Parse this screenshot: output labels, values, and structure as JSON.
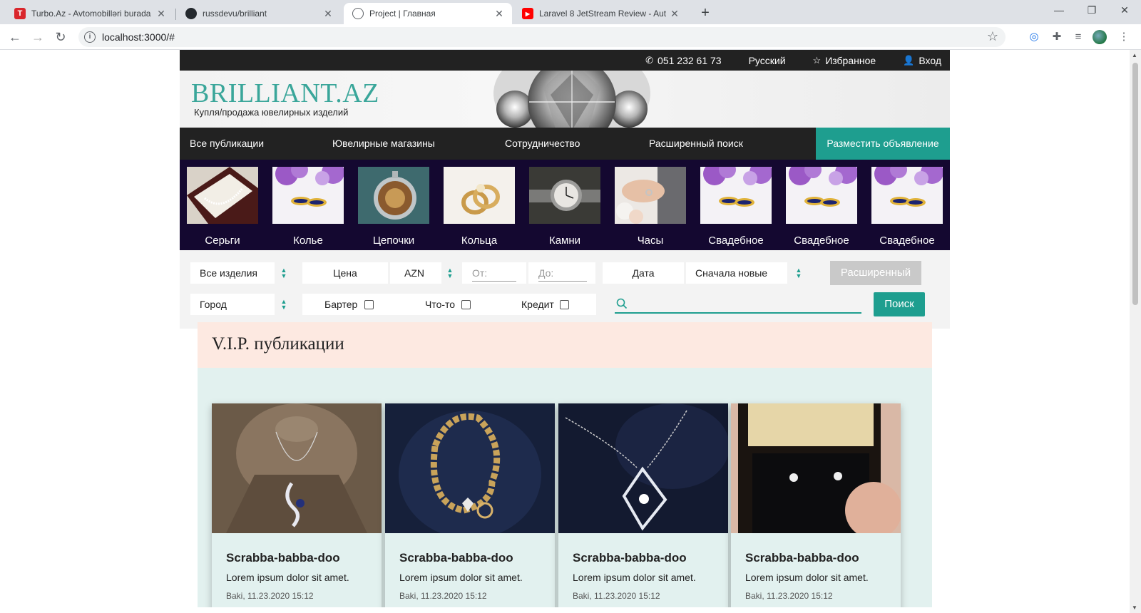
{
  "browser": {
    "tabs": [
      {
        "title": "Turbo.Az - Avtomobillәri burada",
        "favicon": "T"
      },
      {
        "title": "russdevu/brilliant",
        "favicon": ""
      },
      {
        "title": "Project | Главная",
        "favicon": ""
      },
      {
        "title": "Laravel 8 JetStream Review - Aut",
        "favicon": "▶"
      }
    ],
    "url": "localhost:3000/#"
  },
  "topbar": {
    "phone": "051 232 61 73",
    "language": "Русский",
    "favorites": "Избранное",
    "login": "Вход"
  },
  "header": {
    "logo": "BRILLIANT.AZ",
    "tagline": "Купля/продажа ювелирных изделий"
  },
  "nav": {
    "items": [
      "Все публикации",
      "Ювелирные магазины",
      "Сотрудничество",
      "Расширенный поиск"
    ],
    "cta": "Разместить объявление"
  },
  "categories": [
    {
      "label": "Серьги",
      "icon": "pearl-necklace-photo"
    },
    {
      "label": "Колье",
      "icon": "rings-flowers-photo"
    },
    {
      "label": "Цепочки",
      "icon": "pocket-watch-photo"
    },
    {
      "label": "Кольца",
      "icon": "gold-rings-photo"
    },
    {
      "label": "Камни",
      "icon": "wristwatch-photo"
    },
    {
      "label": "Часы",
      "icon": "wedding-hands-photo"
    },
    {
      "label": "Свадебное",
      "icon": "rings-flowers-photo"
    },
    {
      "label": "Свадебное",
      "icon": "rings-flowers-photo"
    },
    {
      "label": "Свадебное",
      "icon": "rings-flowers-photo"
    }
  ],
  "filters": {
    "product": "Все изделия",
    "price_label": "Цена",
    "currency": "AZN",
    "from_placeholder": "От:",
    "to_placeholder": "До:",
    "date_label": "Дата",
    "sort": "Сначала новые",
    "advanced": "Расширенный",
    "city": "Город",
    "barter": "Бартер",
    "something": "Что-то",
    "credit": "Кредит",
    "search_button": "Поиск"
  },
  "vip": {
    "heading": "V.I.P. публикации",
    "cards": [
      {
        "title": "Scrabba-babba-doo",
        "desc": "Lorem ipsum dolor sit amet.",
        "meta": "Baki, 11.23.2020 15:12"
      },
      {
        "title": "Scrabba-babba-doo",
        "desc": "Lorem ipsum dolor sit amet.",
        "meta": "Baki, 11.23.2020 15:12"
      },
      {
        "title": "Scrabba-babba-doo",
        "desc": "Lorem ipsum dolor sit amet.",
        "meta": "Baki, 11.23.2020 15:12"
      },
      {
        "title": "Scrabba-babba-doo",
        "desc": "Lorem ipsum dolor sit amet.",
        "meta": "Baki, 11.23.2020 15:12"
      }
    ]
  },
  "colors": {
    "accent": "#1e9e8f",
    "dark_bar": "#222222",
    "category_bg": "#140830",
    "vip_head": "#fde9e1",
    "vip_body": "#e2f1ef"
  }
}
